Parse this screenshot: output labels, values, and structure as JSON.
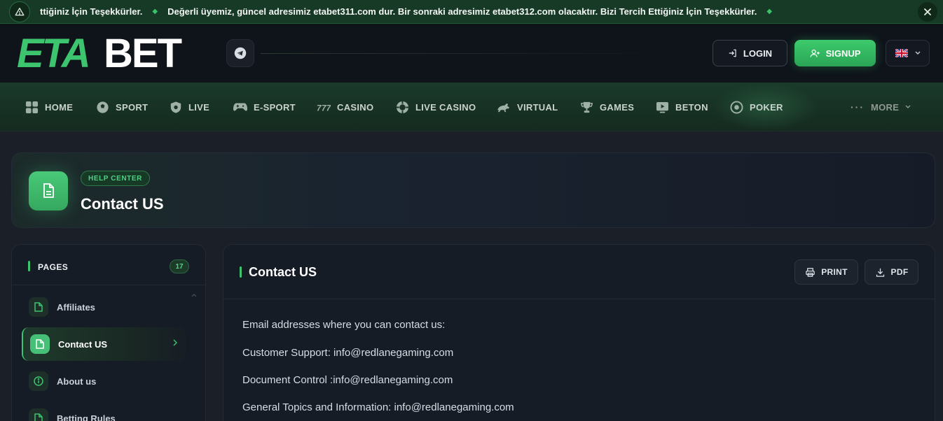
{
  "ticker": {
    "messages": [
      "ttiğiniz İçin Teşekkürler.",
      "Değerli üyemiz, güncel adresimiz etabet311.com dur. Bir sonraki adresimiz etabet312.com olacaktır. Bizi Tercih Ettiğiniz İçin Teşekkürler."
    ]
  },
  "header": {
    "logo_text": "ETABET",
    "login_label": "LOGIN",
    "signup_label": "SIGNUP"
  },
  "nav": {
    "items": [
      "HOME",
      "SPORT",
      "LIVE",
      "E-SPORT",
      "CASINO",
      "LIVE CASINO",
      "VIRTUAL",
      "GAMES",
      "BETON",
      "POKER"
    ],
    "more_label": "MORE"
  },
  "hero": {
    "badge": "HELP CENTER",
    "title": "Contact US"
  },
  "sidebar": {
    "title": "PAGES",
    "count": "17",
    "items": [
      "Affiliates",
      "Contact US",
      "About us",
      "Betting Rules"
    ]
  },
  "content": {
    "title": "Contact US",
    "print_label": "PRINT",
    "pdf_label": "PDF",
    "lines": [
      "Email addresses where you can contact us:",
      "Customer Support: info@redlanegaming.com",
      "Document Control :info@redlanegaming.com",
      "General Topics and Information: info@redlanegaming.com"
    ]
  },
  "colors": {
    "accent": "#3cc46e",
    "background": "#1b1f27",
    "header": "#0f131a"
  }
}
